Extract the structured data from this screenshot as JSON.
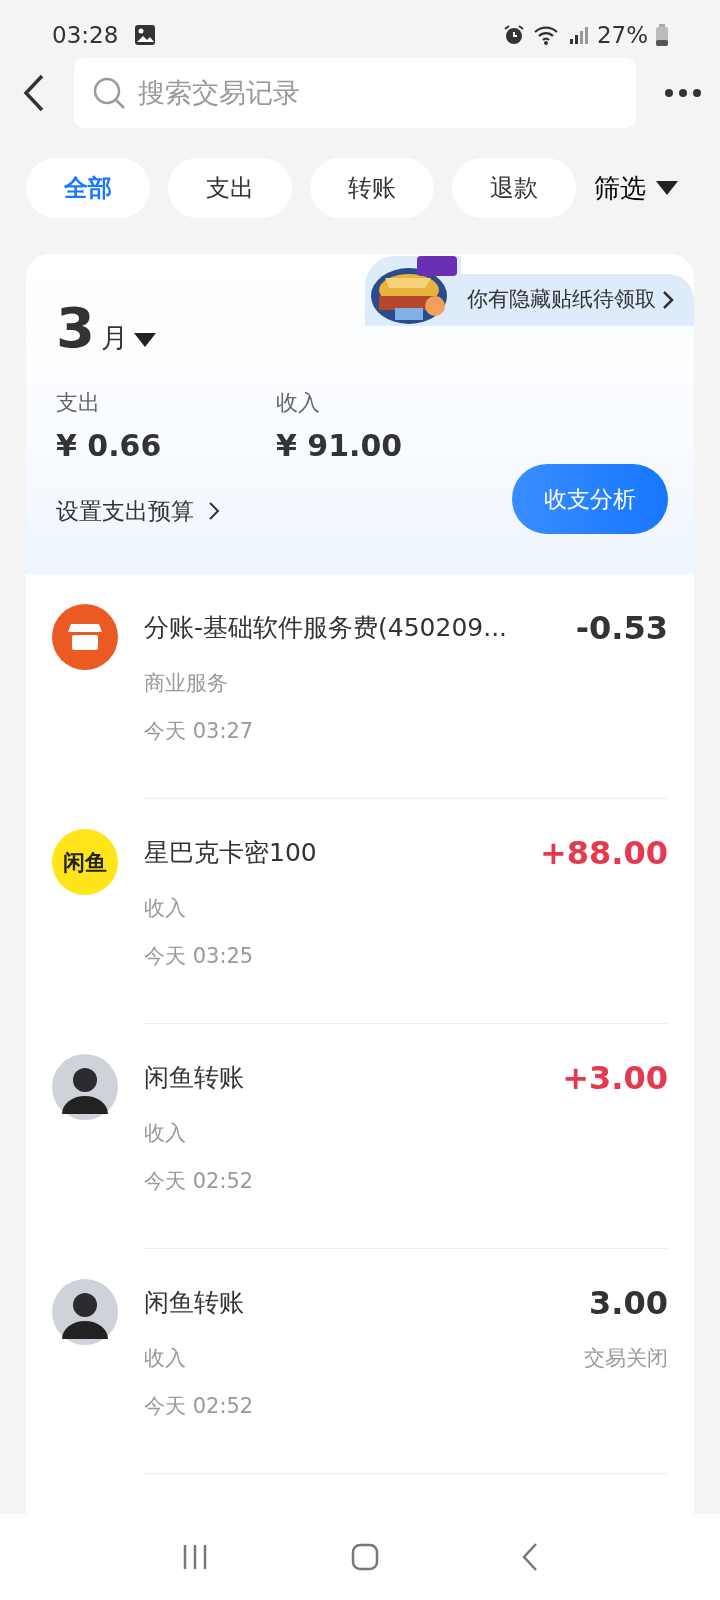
{
  "status_bar": {
    "time": "03:28",
    "battery": "27%"
  },
  "search": {
    "placeholder": "搜索交易记录"
  },
  "filters": [
    {
      "label": "全部",
      "selected": true
    },
    {
      "label": "支出",
      "selected": false
    },
    {
      "label": "转账",
      "selected": false
    },
    {
      "label": "退款",
      "selected": false
    }
  ],
  "filter_menu": "筛选",
  "summary": {
    "month": "3",
    "month_unit": "月",
    "promo": "你有隐藏贴纸待领取",
    "expense_label": "支出",
    "expense": "¥ 0.66",
    "income_label": "收入",
    "income": "¥ 91.00",
    "budget_link": "设置支出预算",
    "analysis_button": "收支分析"
  },
  "transactions": [
    {
      "kind": "store",
      "title": "分账-基础软件服务费(450209...",
      "amount": "-0.53",
      "color": "#333333",
      "category": "商业服务",
      "time": "今天 03:27"
    },
    {
      "kind": "logo",
      "logo_text": "闲鱼",
      "title": "星巴克卡密100",
      "amount": "+88.00",
      "color": "#e6394f",
      "category": "收入",
      "time": "今天 03:25"
    },
    {
      "kind": "avatar",
      "title": "闲鱼转账",
      "amount": "+3.00",
      "color": "#e6394f",
      "category": "收入",
      "time": "今天 02:52"
    },
    {
      "kind": "avatar",
      "title": "闲鱼转账",
      "amount": "3.00",
      "color": "#333333",
      "status": "交易关闭",
      "category": "收入",
      "time": "今天 02:52"
    }
  ]
}
